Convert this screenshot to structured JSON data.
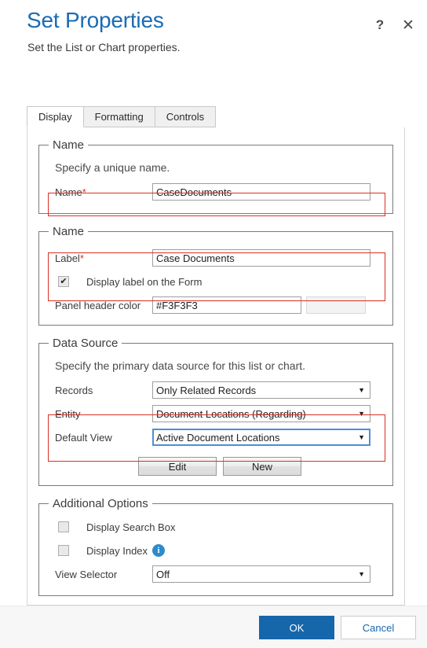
{
  "header": {
    "title": "Set Properties",
    "subtitle": "Set the List or Chart properties.",
    "help_icon": "question-mark-icon",
    "close_icon": "close-x-icon",
    "title_color": "#1a6bb5"
  },
  "tabs": [
    {
      "label": "Display",
      "active": true
    },
    {
      "label": "Formatting",
      "active": false
    },
    {
      "label": "Controls",
      "active": false
    }
  ],
  "sections": {
    "name_unique": {
      "legend": "Name",
      "description": "Specify a unique name.",
      "name_field": {
        "label": "Name",
        "required_marker": "*",
        "value": "CaseDocuments"
      },
      "highlighted": true
    },
    "name_label": {
      "legend": "Name",
      "label_field": {
        "label": "Label",
        "required_marker": "*",
        "value": "Case Documents"
      },
      "display_label_checkbox": {
        "label": "Display label on the Form",
        "checked": true
      },
      "panel_header_color": {
        "label": "Panel header color",
        "value": "#F3F3F3",
        "swatch_color": "#F3F3F3"
      },
      "highlighted": true
    },
    "data_source": {
      "legend": "Data Source",
      "description": "Specify the primary data source for this list or chart.",
      "records": {
        "label": "Records",
        "value": "Only Related Records"
      },
      "entity": {
        "label": "Entity",
        "value": "Document Locations (Regarding)"
      },
      "default_view": {
        "label": "Default View",
        "value": "Active Document Locations",
        "focused": true
      },
      "edit_button": "Edit",
      "new_button": "New",
      "highlighted": true
    },
    "additional_options": {
      "legend": "Additional Options",
      "display_search_box": {
        "label": "Display Search Box",
        "checked": false
      },
      "display_index": {
        "label": "Display Index",
        "checked": false,
        "info_icon": "info-circle-icon",
        "info_icon_color": "#2e8bc9"
      },
      "view_selector": {
        "label": "View Selector",
        "value": "Off"
      }
    }
  },
  "footer": {
    "ok_label": "OK",
    "cancel_label": "Cancel",
    "ok_color": "#1566ab"
  },
  "icons": {
    "dropdown_arrow": "▼",
    "checkmark": "✔",
    "info_letter": "i"
  }
}
